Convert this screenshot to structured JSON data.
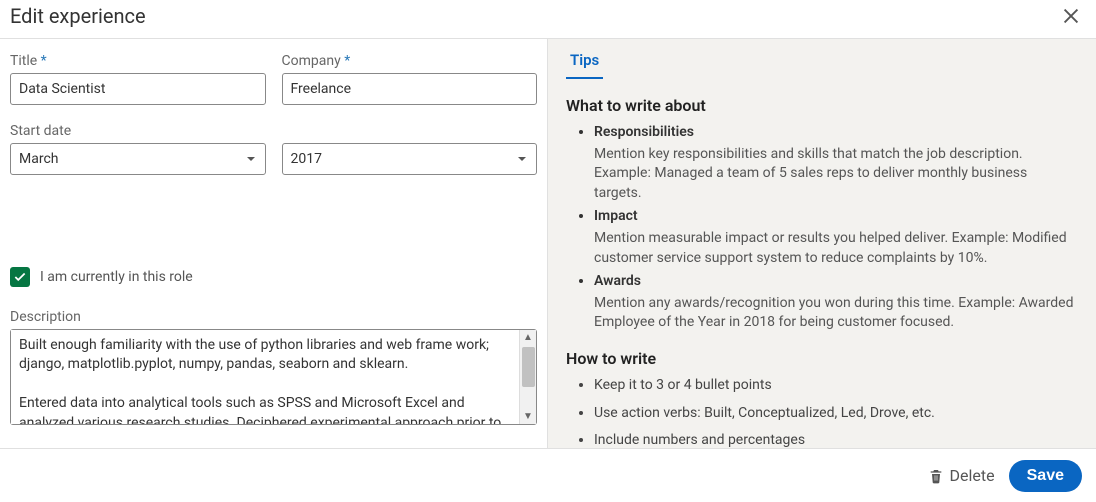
{
  "header": {
    "title": "Edit experience"
  },
  "form": {
    "title_label": "Title",
    "title_value": "Data Scientist",
    "company_label": "Company",
    "company_value": "Freelance",
    "start_date_label": "Start date",
    "start_month": "March",
    "start_year": "2017",
    "current_role_label": "I am currently in this role",
    "current_role_checked": true,
    "description_label": "Description",
    "description_value": "Built enough familiarity with the use of python libraries and web frame work; django, matplotlib.pyplot, numpy, pandas, seaborn and sklearn.\n\nEntered data into analytical tools such as SPSS and Microsoft Excel and analyzed various research studies. Deciphered experimental approach prior to"
  },
  "tips": {
    "tab_label": "Tips",
    "section1_heading": "What to write about",
    "section1_items": [
      {
        "title": "Responsibilities",
        "desc": "Mention key responsibilities and skills that match the job description. Example: Managed a team of 5 sales reps to deliver monthly business targets."
      },
      {
        "title": "Impact",
        "desc": "Mention measurable impact or results you helped deliver. Example: Modified customer service support system to reduce complaints by 10%."
      },
      {
        "title": "Awards",
        "desc": "Mention any awards/recognition you won during this time. Example: Awarded Employee of the Year in 2018 for being customer focused."
      }
    ],
    "section2_heading": "How to write",
    "section2_items": [
      "Keep it to 3 or 4 bullet points",
      "Use action verbs: Built, Conceptualized, Led, Drove, etc.",
      "Include numbers and percentages"
    ]
  },
  "footer": {
    "delete_label": "Delete",
    "save_label": "Save"
  }
}
